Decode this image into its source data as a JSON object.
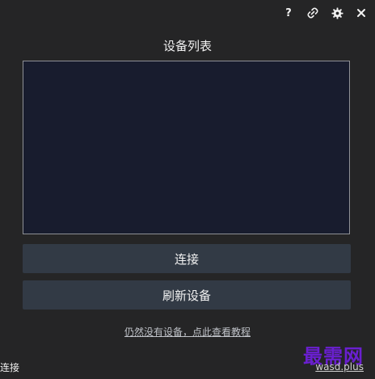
{
  "titlebar": {
    "help_label": "?"
  },
  "page": {
    "title": "设备列表"
  },
  "buttons": {
    "connect": "连接",
    "refresh": "刷新设备"
  },
  "help_link": "仍然没有设备，点此查看教程",
  "status": "连接",
  "watermark": {
    "logo": "最需网",
    "site": "wasd.plus"
  },
  "colors": {
    "background": "#252526",
    "device_list_bg": "#181c2e",
    "button_bg": "#323a45",
    "watermark_logo": "#6a1fd0"
  },
  "icons": [
    "help-icon",
    "link-icon",
    "gear-icon",
    "close-icon"
  ]
}
